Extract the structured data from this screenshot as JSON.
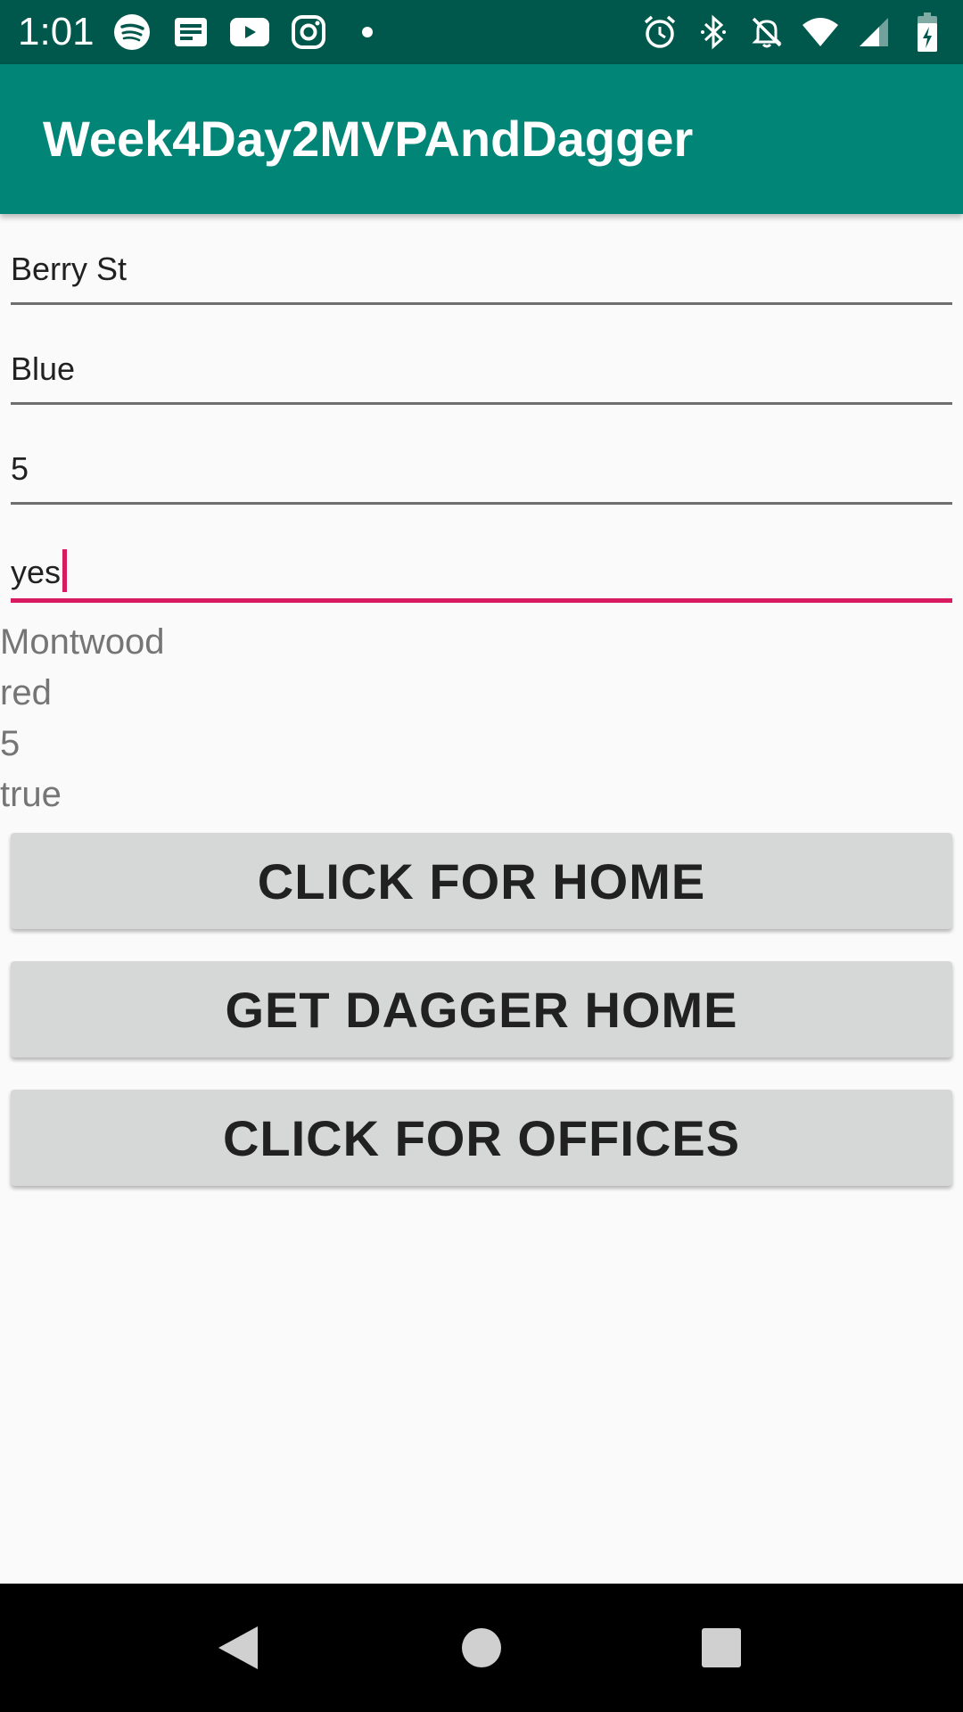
{
  "status_bar": {
    "time": "1:01",
    "left_icons": [
      "spotify-icon",
      "news-icon",
      "youtube-icon",
      "instagram-icon",
      "dot-icon"
    ],
    "right_icons": [
      "alarm-icon",
      "bluetooth-icon",
      "notifications-off-icon",
      "wifi-icon",
      "signal-icon",
      "battery-charging-icon"
    ]
  },
  "app_bar": {
    "title": "Week4Day2MVPAndDagger"
  },
  "form": {
    "street_value": "Berry St",
    "color_value": "Blue",
    "number_value": "5",
    "flag_value": "yes"
  },
  "results": {
    "street": "Montwood",
    "color": "red",
    "number": "5",
    "flag": "true"
  },
  "buttons": {
    "home_label": "CLICK FOR HOME",
    "dagger_home_label": "GET DAGGER HOME",
    "offices_label": "CLICK FOR OFFICES"
  },
  "nav_bar": {
    "icons": [
      "back-icon",
      "home-icon",
      "recents-icon"
    ]
  },
  "colors": {
    "status_bar": "#00574b",
    "app_bar": "#008577",
    "accent": "#d81b60",
    "button_bg": "#d6d7d7"
  }
}
